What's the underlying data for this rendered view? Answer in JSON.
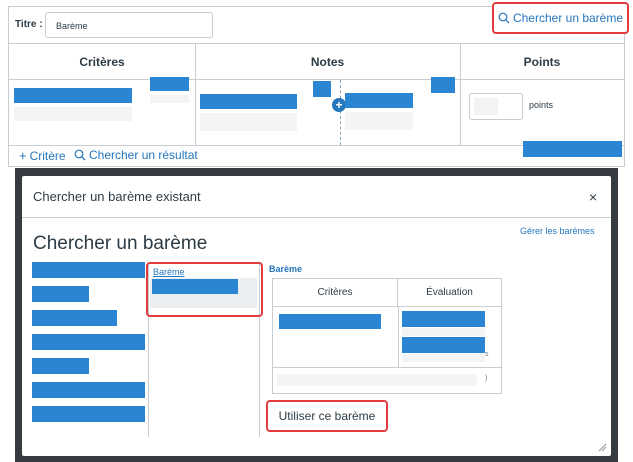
{
  "rubric_editor": {
    "title_label": "Titre :",
    "title_value": "Barème",
    "find_rubric_label": "Chercher un barème",
    "columns": [
      "Critères",
      "Notes",
      "Points"
    ],
    "points_unit": "points",
    "add_criterion_label": "Critère",
    "find_outcome_label": "Chercher un résultat"
  },
  "modal": {
    "title": "Chercher un barème existant",
    "close_symbol": "×",
    "manage_link": "Gérer les barèmes",
    "heading": "Chercher un barème",
    "rubric_list_title": "Barème",
    "preview_title": "Barème",
    "preview_columns": [
      "Critères",
      "Évaluation"
    ],
    "preview_fragment_1": "s",
    "preview_fragment_2": ")",
    "use_button": "Utiliser ce barème"
  },
  "colors": {
    "accent": "#2476bd",
    "redacted_block": "#2a85d3",
    "highlight": "#e03e3e",
    "overlay": "#353b40"
  },
  "icons": [
    "search-icon",
    "plus-icon",
    "add-circle-icon",
    "close-icon",
    "resize-grip-icon"
  ]
}
